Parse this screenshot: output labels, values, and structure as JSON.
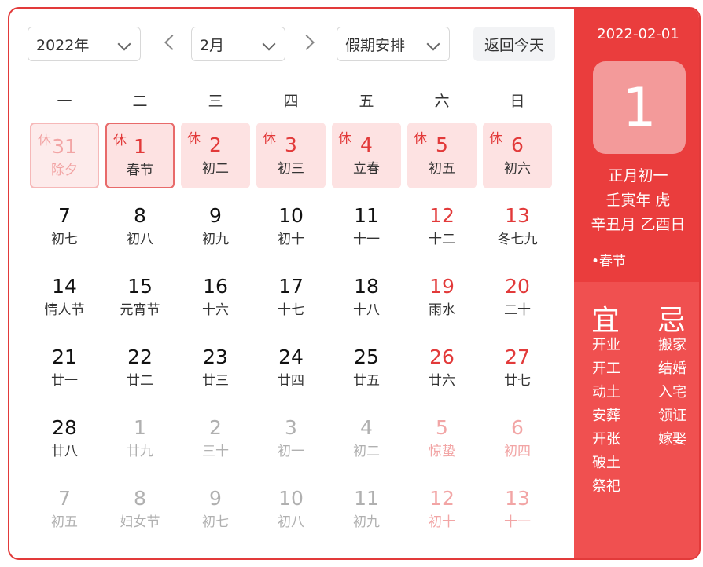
{
  "toolbar": {
    "year": "2022年",
    "month": "2月",
    "holiday": "假期安排",
    "today": "返回今天"
  },
  "weekdays": [
    "一",
    "二",
    "三",
    "四",
    "五",
    "六",
    "日"
  ],
  "days": [
    {
      "n": "31",
      "s": "除夕",
      "rest": "休"
    },
    {
      "n": "1",
      "s": "春节",
      "rest": "休"
    },
    {
      "n": "2",
      "s": "初二",
      "rest": "休"
    },
    {
      "n": "3",
      "s": "初三",
      "rest": "休"
    },
    {
      "n": "4",
      "s": "立春",
      "rest": "休"
    },
    {
      "n": "5",
      "s": "初五",
      "rest": "休"
    },
    {
      "n": "6",
      "s": "初六",
      "rest": "休"
    },
    {
      "n": "7",
      "s": "初七"
    },
    {
      "n": "8",
      "s": "初八"
    },
    {
      "n": "9",
      "s": "初九"
    },
    {
      "n": "10",
      "s": "初十"
    },
    {
      "n": "11",
      "s": "十一"
    },
    {
      "n": "12",
      "s": "十二"
    },
    {
      "n": "13",
      "s": "冬七九"
    },
    {
      "n": "14",
      "s": "情人节"
    },
    {
      "n": "15",
      "s": "元宵节"
    },
    {
      "n": "16",
      "s": "十六"
    },
    {
      "n": "17",
      "s": "十七"
    },
    {
      "n": "18",
      "s": "十八"
    },
    {
      "n": "19",
      "s": "雨水"
    },
    {
      "n": "20",
      "s": "二十"
    },
    {
      "n": "21",
      "s": "廿一"
    },
    {
      "n": "22",
      "s": "廿二"
    },
    {
      "n": "23",
      "s": "廿三"
    },
    {
      "n": "24",
      "s": "廿四"
    },
    {
      "n": "25",
      "s": "廿五"
    },
    {
      "n": "26",
      "s": "廿六"
    },
    {
      "n": "27",
      "s": "廿七"
    },
    {
      "n": "28",
      "s": "廿八"
    },
    {
      "n": "1",
      "s": "廿九"
    },
    {
      "n": "2",
      "s": "三十"
    },
    {
      "n": "3",
      "s": "初一"
    },
    {
      "n": "4",
      "s": "初二"
    },
    {
      "n": "5",
      "s": "惊蛰"
    },
    {
      "n": "6",
      "s": "初四"
    },
    {
      "n": "7",
      "s": "初五"
    },
    {
      "n": "8",
      "s": "妇女节"
    },
    {
      "n": "9",
      "s": "初七"
    },
    {
      "n": "10",
      "s": "初八"
    },
    {
      "n": "11",
      "s": "初九"
    },
    {
      "n": "12",
      "s": "初十"
    },
    {
      "n": "13",
      "s": "十一"
    }
  ],
  "panel": {
    "date": "2022-02-01",
    "day": "1",
    "lunar": "正月初一",
    "year_gz": "壬寅年 虎",
    "month_day_gz": "辛丑月 乙酉日",
    "festival": "•春节",
    "yi_title": "宜",
    "ji_title": "忌",
    "yi": [
      "开业",
      "开工",
      "动土",
      "安葬",
      "开张",
      "破土",
      "祭祀"
    ],
    "ji": [
      "搬家",
      "结婚",
      "入宅",
      "领证",
      "嫁娶"
    ]
  },
  "colors": {
    "accent": "#e23a3a",
    "holiday_bg": "#fde2e2",
    "panel_bg": "#ea3d3d"
  }
}
